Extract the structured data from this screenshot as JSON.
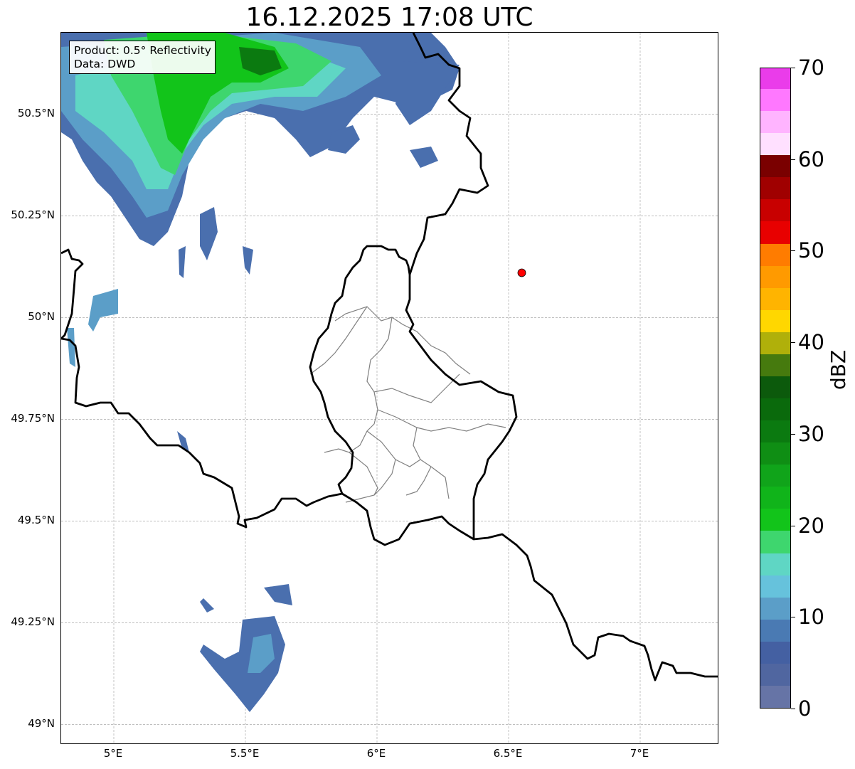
{
  "title": "16.12.2025 17:08 UTC",
  "info_box": {
    "product": "Product: 0.5° Reflectivity",
    "source": "Data: DWD"
  },
  "map": {
    "lat_labels": [
      "50.5°N",
      "50.25°N",
      "50°N",
      "49.75°N",
      "49.5°N",
      "49.25°N",
      "49°N"
    ],
    "lat_values": [
      50.5,
      50.25,
      50.0,
      49.75,
      49.5,
      49.25,
      49.0
    ],
    "lon_labels": [
      "5°E",
      "5.5°E",
      "6°E",
      "6.5°E",
      "7°E"
    ],
    "lon_values": [
      5.0,
      5.5,
      6.0,
      6.5,
      7.0
    ],
    "lon_range": [
      4.8,
      7.3
    ],
    "lat_range": [
      48.95,
      50.7
    ],
    "grid": true,
    "marker": {
      "lon": 6.55,
      "lat": 50.11,
      "color": "#ff0000"
    }
  },
  "colorbar": {
    "label": "dBZ",
    "range": [
      0,
      70
    ],
    "tick_labels": [
      "0",
      "10",
      "20",
      "30",
      "40",
      "50",
      "60",
      "70"
    ],
    "tick_values": [
      0,
      10,
      20,
      30,
      40,
      50,
      60,
      70
    ],
    "colors": [
      "#6674a6",
      "#5066a0",
      "#4460a2",
      "#4a7ab3",
      "#5b9ec8",
      "#66c2dc",
      "#5fd6c4",
      "#3ed66e",
      "#12c41a",
      "#10b41a",
      "#10a41a",
      "#0f8e14",
      "#0b7a10",
      "#0a6a0c",
      "#0c5a0c",
      "#467a0e",
      "#b0b00a",
      "#ffd700",
      "#ffb400",
      "#ff9a00",
      "#ff7c00",
      "#e80000",
      "#c80000",
      "#a00000",
      "#7a0000",
      "#ffe0ff",
      "#ffb4ff",
      "#ff78ff",
      "#ea3cea"
    ]
  },
  "colors": {
    "border": "#000000",
    "district_border": "#808080",
    "grid": "#aaaaaa"
  }
}
